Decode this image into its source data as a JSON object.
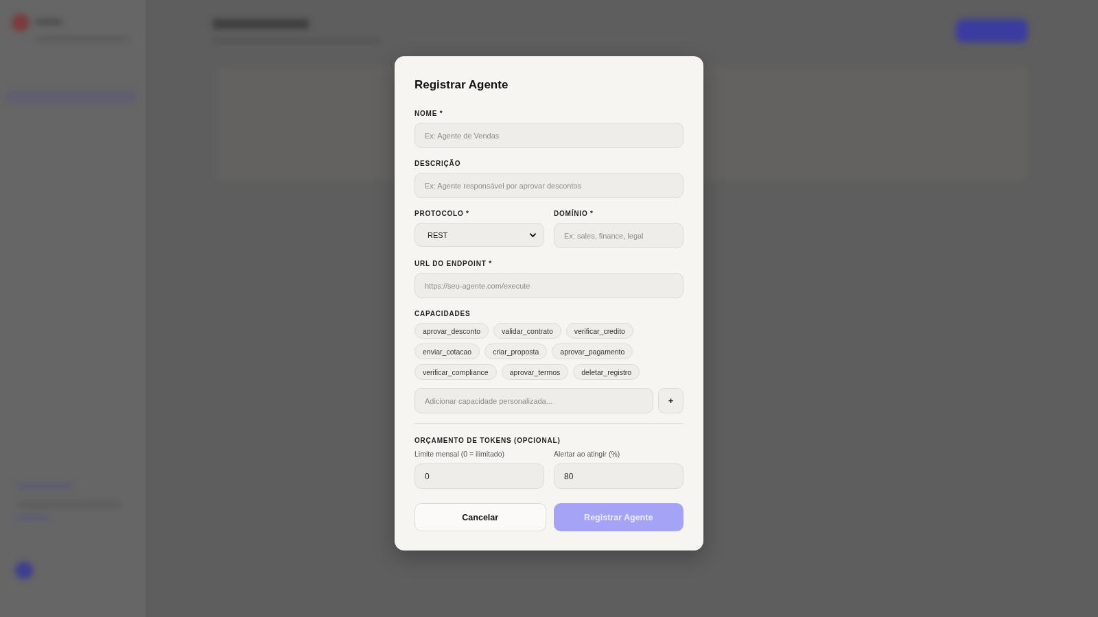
{
  "modal": {
    "title": "Registrar Agente",
    "fields": [
      {
        "label": "NOME *",
        "placeholder": "Ex: Agente de Vendas"
      },
      {
        "label": "DESCRIÇÃO",
        "placeholder": "Ex: Agente responsável por aprovar descontos"
      }
    ],
    "protocol": {
      "label": "PROTOCOLO *",
      "value": "REST"
    },
    "domain": {
      "label": "DOMÍNIO *",
      "placeholder": "Ex: sales, finance, legal"
    },
    "endpoint": {
      "label": "URL DO ENDPOINT *",
      "placeholder": "https://seu-agente.com/execute"
    },
    "capabilities": {
      "label": "CAPACIDADES",
      "chips": [
        "aprovar_desconto",
        "validar_contrato",
        "verificar_credito",
        "enviar_cotacao",
        "criar_proposta",
        "aprovar_pagamento",
        "verificar_compliance",
        "aprovar_termos",
        "deletar_registro"
      ],
      "placeholder": "Adicionar capacidade personalizada...",
      "add_button": "+"
    },
    "budget": {
      "label": "ORÇAMENTO DE TOKENS (OPCIONAL)",
      "fields": [
        {
          "label": "Limite mensal (0 = ilimitado)",
          "value": "0"
        },
        {
          "label": "Alertar ao atingir (%)",
          "value": "80"
        }
      ]
    },
    "cancel_button": "Cancelar",
    "submit_button": {
      "label": "Registrar Agente",
      "disabled": true
    }
  }
}
